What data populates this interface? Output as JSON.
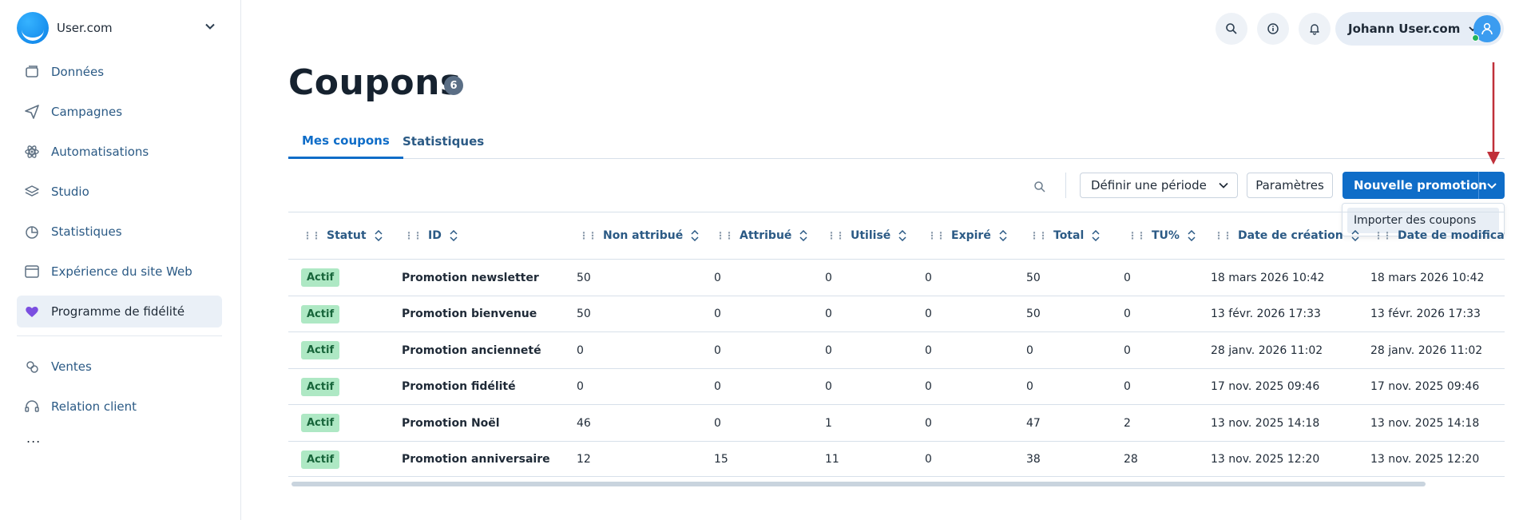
{
  "brand": {
    "name": "User.com",
    "logo_icon": "user-com-logo-icon"
  },
  "sidebar": {
    "items": [
      {
        "label": "Données",
        "icon": "database-icon"
      },
      {
        "label": "Campagnes",
        "icon": "paper-plane-icon"
      },
      {
        "label": "Automatisations",
        "icon": "atom-icon"
      },
      {
        "label": "Studio",
        "icon": "layers-icon"
      },
      {
        "label": "Statistiques",
        "icon": "pie-chart-icon"
      },
      {
        "label": "Expérience du site Web",
        "icon": "browser-window-icon"
      },
      {
        "label": "Programme de fidélité",
        "icon": "heart-icon",
        "active": true
      }
    ],
    "secondary_items": [
      {
        "label": "Ventes",
        "icon": "sales-icon"
      },
      {
        "label": "Relation client",
        "icon": "headset-icon"
      }
    ],
    "more_label": "..."
  },
  "topbar": {
    "user_name": "Johann User.com",
    "icons": [
      "search-icon",
      "info-icon",
      "bell-icon"
    ]
  },
  "page": {
    "title": "Coupons",
    "count": "6"
  },
  "tabs": [
    {
      "label": "Mes coupons",
      "active": true
    },
    {
      "label": "Statistiques",
      "active": false
    }
  ],
  "toolbar": {
    "period_label": "Définir une période",
    "params_label": "Paramètres",
    "primary_label": "Nouvelle promotion",
    "dropdown_item": "Importer des coupons"
  },
  "table": {
    "columns": [
      "Statut",
      "ID",
      "Non attribué",
      "Attribué",
      "Utilisé",
      "Expiré",
      "Total",
      "TU%",
      "Date de création",
      "Date de modification"
    ],
    "rows": [
      {
        "status": "Actif",
        "id": "Promotion newsletter",
        "non_attribue": "50",
        "attribue": "0",
        "utilise": "0",
        "expire": "0",
        "total": "50",
        "tu": "0",
        "created": "18 mars 2026 10:42",
        "modified": "18 mars 2026 10:42"
      },
      {
        "status": "Actif",
        "id": "Promotion bienvenue",
        "non_attribue": "50",
        "attribue": "0",
        "utilise": "0",
        "expire": "0",
        "total": "50",
        "tu": "0",
        "created": "13 févr. 2026 17:33",
        "modified": "13 févr. 2026 17:33"
      },
      {
        "status": "Actif",
        "id": "Promotion ancienneté",
        "non_attribue": "0",
        "attribue": "0",
        "utilise": "0",
        "expire": "0",
        "total": "0",
        "tu": "0",
        "created": "28 janv. 2026 11:02",
        "modified": "28 janv. 2026 11:02"
      },
      {
        "status": "Actif",
        "id": "Promotion fidélité",
        "non_attribue": "0",
        "attribue": "0",
        "utilise": "0",
        "expire": "0",
        "total": "0",
        "tu": "0",
        "created": "17 nov. 2025 09:46",
        "modified": "17 nov. 2025 09:46"
      },
      {
        "status": "Actif",
        "id": "Promotion Noël",
        "non_attribue": "46",
        "attribue": "0",
        "utilise": "1",
        "expire": "0",
        "total": "47",
        "tu": "2",
        "created": "13 nov. 2025 14:18",
        "modified": "13 nov. 2025 14:18"
      },
      {
        "status": "Actif",
        "id": "Promotion anniversaire",
        "non_attribue": "12",
        "attribue": "15",
        "utilise": "11",
        "expire": "0",
        "total": "38",
        "tu": "28",
        "created": "13 nov. 2025 12:20",
        "modified": "13 nov. 2025 12:20"
      }
    ]
  },
  "colors": {
    "accent": "#0f6dc8",
    "status_bg": "#aee8c4",
    "annotation": "#c0303a"
  }
}
